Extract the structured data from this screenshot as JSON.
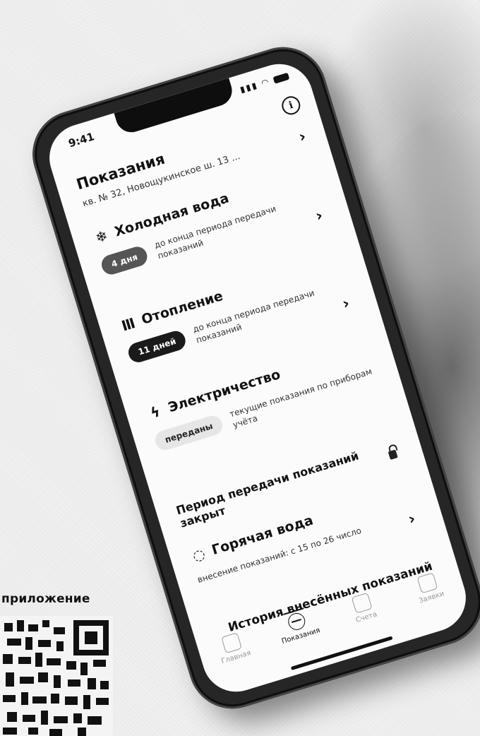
{
  "promo": {
    "text": "приложение"
  },
  "status_bar": {
    "time": "9:41"
  },
  "header": {
    "title": "Показания",
    "address": "кв. № 32, Новощукинское ш. 13 ..."
  },
  "cards": [
    {
      "title": "Холодная вода",
      "icon": "snowflake-icon",
      "badge": "4 дня",
      "description": "до конца периода передачи показаний"
    },
    {
      "title": "Отопление",
      "icon": "radiator-icon",
      "badge": "11 дней",
      "description": "до конца периода передачи показаний"
    },
    {
      "title": "Электричество",
      "icon": "lightning-icon",
      "badge": "переданы",
      "description": "текущие показания по приборам учёта"
    }
  ],
  "closed_section": {
    "title": "Период передачи показаний закрыт",
    "item": {
      "title": "Горячая вода",
      "icon": "hot-water-icon",
      "description": "внесение показаний: с 15 по 26 число"
    }
  },
  "history": {
    "title": "История внесённых показаний"
  },
  "tabs": [
    {
      "label": "Главная",
      "icon": "home-icon"
    },
    {
      "label": "Показания",
      "icon": "meter-icon"
    },
    {
      "label": "Счета",
      "icon": "bill-icon"
    },
    {
      "label": "Заявки",
      "icon": "pen-icon"
    }
  ]
}
